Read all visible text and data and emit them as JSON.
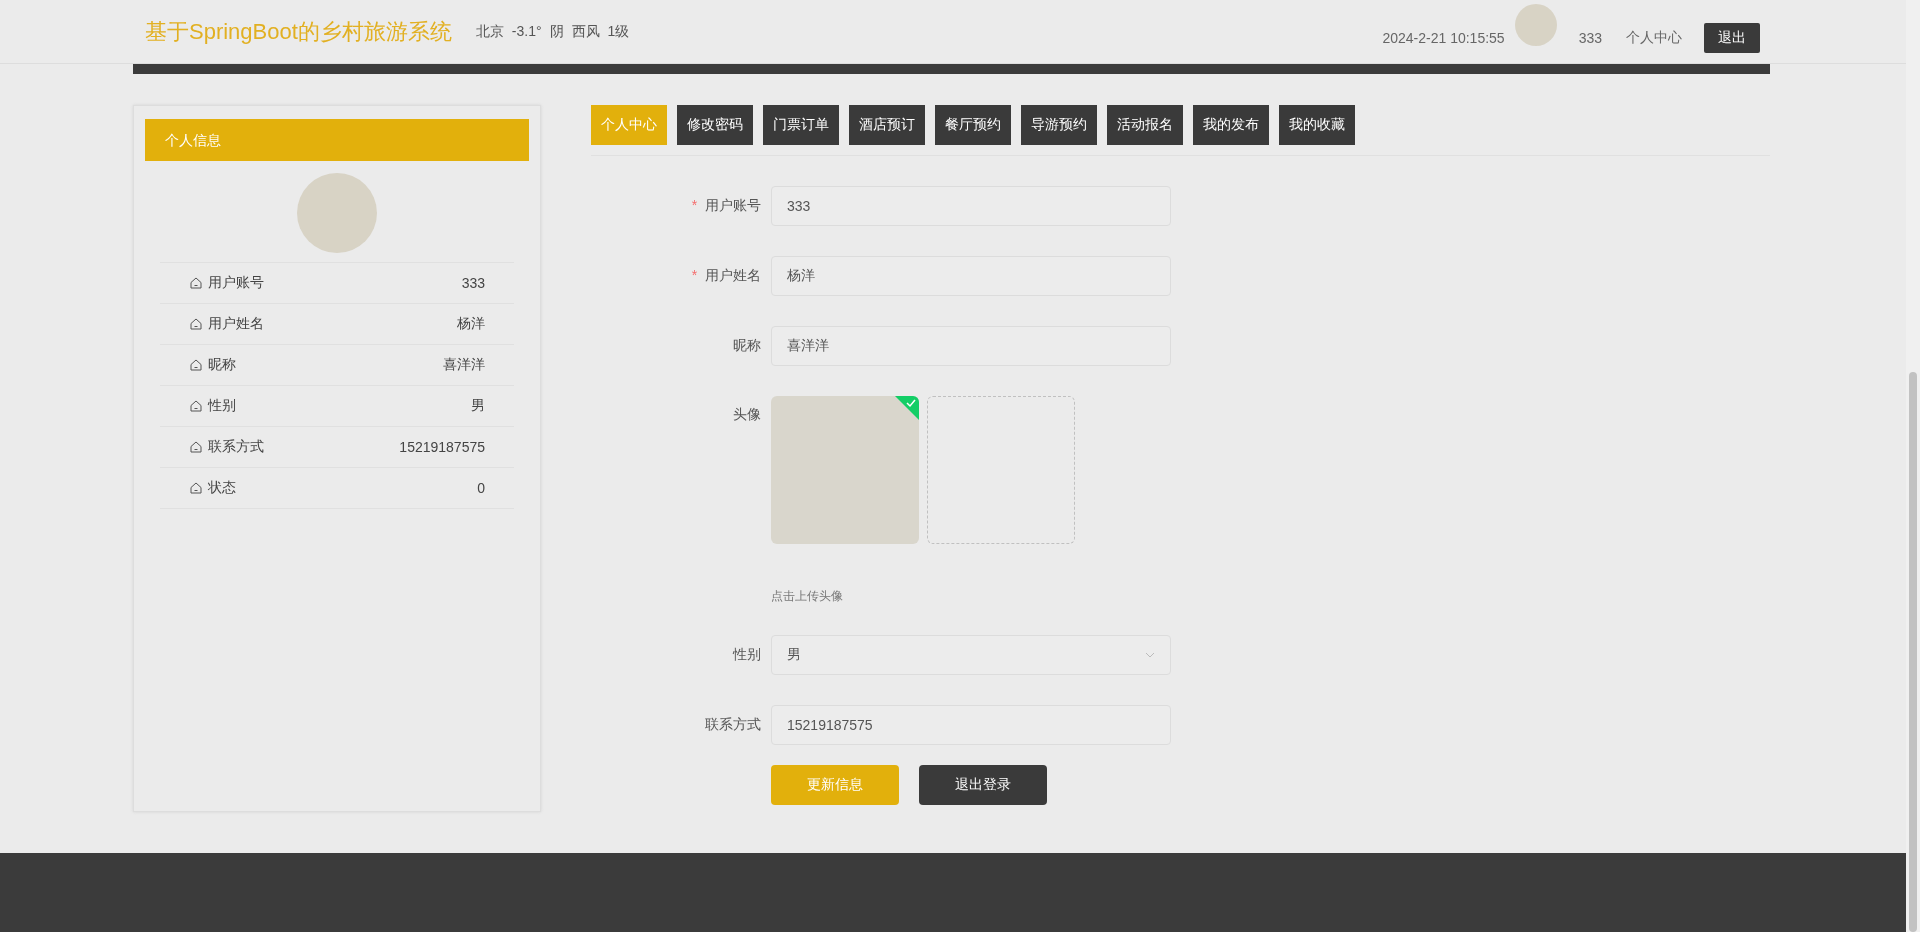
{
  "header": {
    "title": "基于SpringBoot的乡村旅游系统",
    "weather": [
      "北京",
      "-3.1°",
      "阴",
      "西风",
      "1级"
    ],
    "datetime": "2024-2-21 10:15:55",
    "username": "333",
    "profile_link": "个人中心",
    "logout_button": "退出"
  },
  "sidebar": {
    "title": "个人信息",
    "rows": [
      {
        "label": "用户账号",
        "value": "333"
      },
      {
        "label": "用户姓名",
        "value": "杨洋"
      },
      {
        "label": "昵称",
        "value": "喜洋洋"
      },
      {
        "label": "性别",
        "value": "男"
      },
      {
        "label": "联系方式",
        "value": "15219187575"
      },
      {
        "label": "状态",
        "value": "0"
      }
    ]
  },
  "tabs": [
    {
      "label": "个人中心",
      "selected": true
    },
    {
      "label": "修改密码",
      "selected": false
    },
    {
      "label": "门票订单",
      "selected": false
    },
    {
      "label": "酒店预订",
      "selected": false
    },
    {
      "label": "餐厅预约",
      "selected": false
    },
    {
      "label": "导游预约",
      "selected": false
    },
    {
      "label": "活动报名",
      "selected": false
    },
    {
      "label": "我的发布",
      "selected": false
    },
    {
      "label": "我的收藏",
      "selected": false
    }
  ],
  "form": {
    "fields": [
      {
        "kind": "text",
        "label": "用户账号",
        "required_mark": "*",
        "value": "333"
      },
      {
        "kind": "text",
        "label": "用户姓名",
        "required_mark": "*",
        "value": "杨洋"
      },
      {
        "kind": "text",
        "label": "昵称",
        "value": "喜洋洋"
      },
      {
        "kind": "avatar",
        "label": "头像",
        "uploaded": true,
        "hint": "点击上传头像"
      },
      {
        "kind": "select",
        "label": "性别",
        "value": "男"
      },
      {
        "kind": "text",
        "label": "联系方式",
        "value": "15219187575"
      }
    ],
    "buttons": [
      {
        "label": "更新信息",
        "kind": "primary"
      },
      {
        "label": "退出登录",
        "kind": "dark"
      }
    ]
  }
}
